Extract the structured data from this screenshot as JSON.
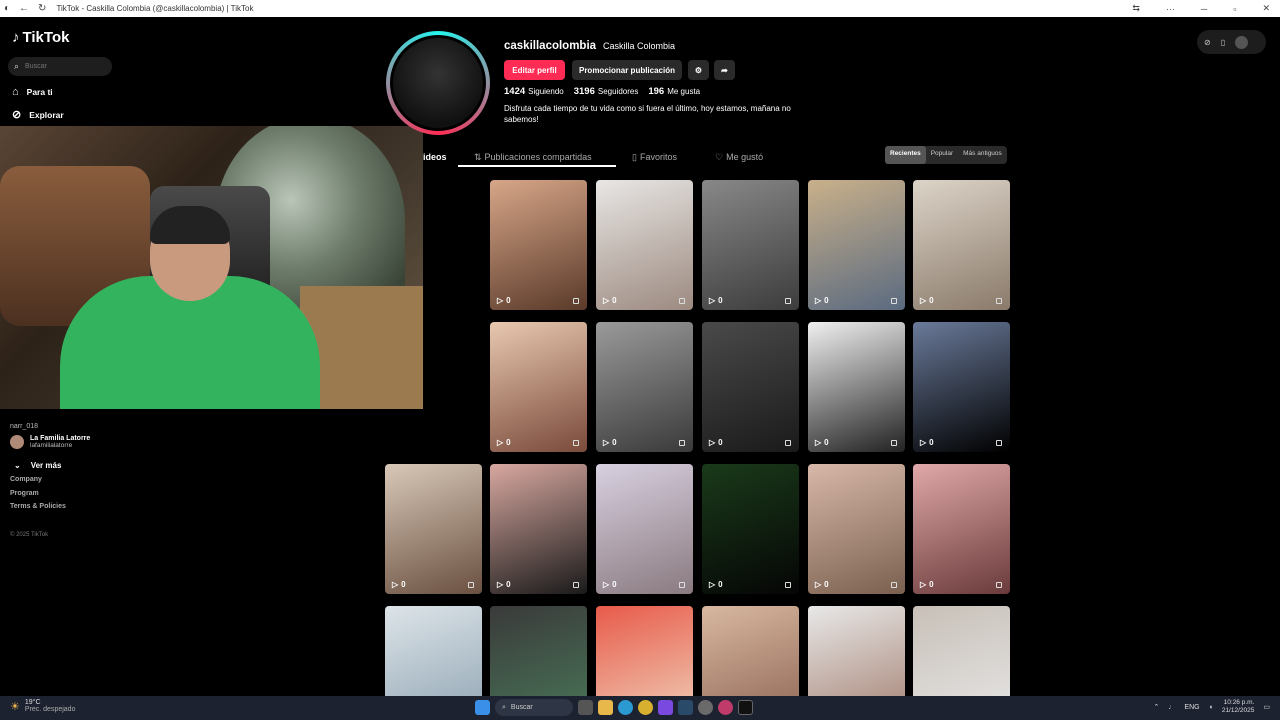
{
  "browser": {
    "title": "TikTok - Caskilla Colombia (@caskillacolombia) | TikTok"
  },
  "sidebar": {
    "logo": "TikTok",
    "search_placeholder": "Buscar",
    "nav": [
      "Para ti",
      "Explorar"
    ],
    "following_partial": "narr_018",
    "account": {
      "name": "La Familia Latorre",
      "handle": "lafamilialatorre"
    },
    "see_more": "Ver más",
    "footer": [
      "Company",
      "Program",
      "Terms & Policies"
    ],
    "copyright": "© 2025 TikTok"
  },
  "profile": {
    "username": "caskillacolombia",
    "nickname": "Caskilla Colombia",
    "edit_button": "Editar perfil",
    "promote_button": "Promocionar publicación",
    "following_count": "1424",
    "following_label": "Siguiendo",
    "followers_count": "3196",
    "followers_label": "Seguidores",
    "likes_count": "196",
    "likes_label": "Me gusta",
    "bio": "Disfruta cada tiempo de tu vida como si fuera el último, hoy estamos, mañana no sabemos!"
  },
  "tabs": [
    "ideos",
    "Publicaciones compartidas",
    "Favoritos",
    "Me gustó"
  ],
  "sort": [
    "Recientes",
    "Popular",
    "Más antiguos"
  ],
  "tile_count": "0",
  "tiles": [
    {
      "c1": "#b85a30",
      "c2": "#3a1a10",
      "lock": true
    },
    {
      "c1": "#d7a688",
      "c2": "#5a3a2a",
      "lock": true
    },
    {
      "c1": "#e8e6e4",
      "c2": "#9c8a80",
      "lock": true
    },
    {
      "c1": "#888",
      "c2": "#3c3c3c",
      "lock": true
    },
    {
      "c1": "#c9b08a",
      "c2": "#5a6a80",
      "lock": true
    },
    {
      "c1": "#dcd4c8",
      "c2": "#8a7a6a",
      "lock": true
    },
    {
      "c1": "#6a6a70",
      "c2": "#2a2a30",
      "lock": true
    },
    {
      "c1": "#e8c8b0",
      "c2": "#7a4a3a",
      "lock": false
    },
    {
      "c1": "#9a9a9a",
      "c2": "#3a3a3a",
      "lock": true
    },
    {
      "c1": "#4a4a4a",
      "c2": "#1a1a1a",
      "lock": true
    },
    {
      "c1": "#f0f0f0",
      "c2": "#222",
      "lock": true
    },
    {
      "c1": "#6a7a9a",
      "c2": "#000",
      "lock": true
    },
    {
      "c1": "#d8c8b8",
      "c2": "#6a5040",
      "lock": true
    },
    {
      "c1": "#d8a8a0",
      "c2": "#1a1a1a",
      "lock": true
    },
    {
      "c1": "#d8d0e0",
      "c2": "#8a7a80",
      "lock": true
    },
    {
      "c1": "#1a3a1a",
      "c2": "#050505",
      "lock": true
    },
    {
      "c1": "#d8b8a8",
      "c2": "#7a6050",
      "lock": true
    },
    {
      "c1": "#e0a8a8",
      "c2": "#6a3a3a",
      "lock": true
    },
    {
      "c1": "#dde4e8",
      "c2": "#8aa0b0",
      "lock": true
    },
    {
      "c1": "#3a3a3a",
      "c2": "#4a7a5a",
      "lock": true
    },
    {
      "c1": "#e85a4a",
      "c2": "#f0d8c0",
      "lock": true
    },
    {
      "c1": "#d8b8a0",
      "c2": "#8a6050",
      "lock": true
    },
    {
      "c1": "#e8e8e8",
      "c2": "#a07a6a",
      "lock": true
    },
    {
      "c1": "#c8c0b8",
      "c2": "#e8e8e8",
      "lock": true
    }
  ],
  "taskbar": {
    "temp": "19°C",
    "weather": "Prec. despejado",
    "search": "Buscar",
    "lang": "ENG",
    "time": "10:26 p.m.",
    "date": "21/12/2025"
  }
}
